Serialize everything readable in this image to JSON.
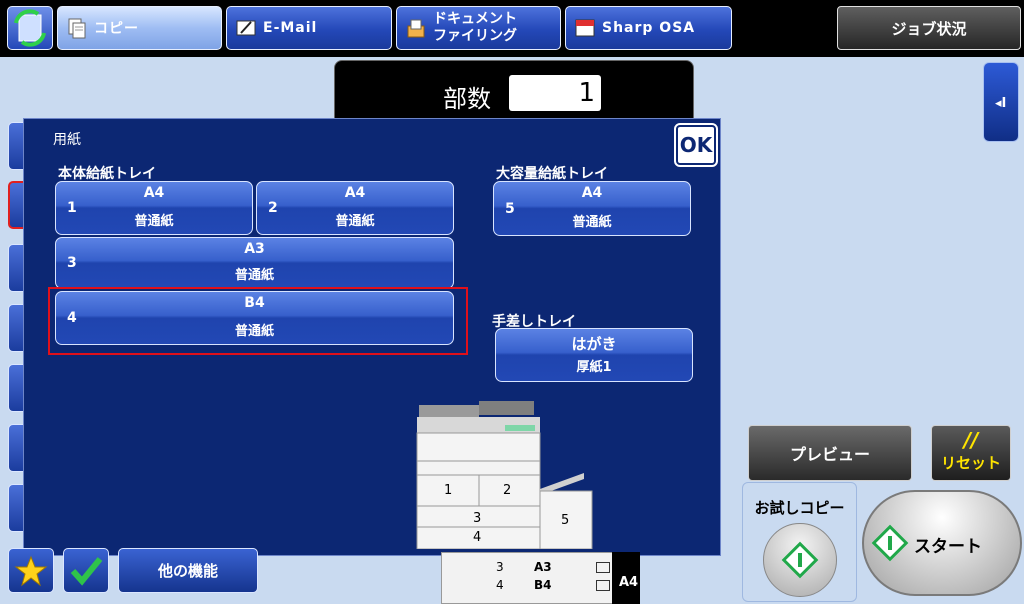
{
  "tabs": [
    {
      "label": "コピー",
      "icon": "copy-icon"
    },
    {
      "label": "E-Mail",
      "icon": "email-icon"
    },
    {
      "label_line1": "ドキュメント",
      "label_line2": "ファイリング",
      "icon": "document-filing-icon"
    },
    {
      "label": "Sharp OSA",
      "icon": "osa-icon"
    }
  ],
  "job_status_label": "ジョブ状況",
  "copies": {
    "label": "部数",
    "value": "1"
  },
  "dialog": {
    "title": "用紙",
    "ok_label": "OK",
    "main_tray_label": "本体給紙トレイ",
    "lcc_label": "大容量給紙トレイ",
    "bypass_label": "手差しトレイ",
    "trays": [
      {
        "num": "1",
        "size": "A4",
        "type": "普通紙"
      },
      {
        "num": "2",
        "size": "A4",
        "type": "普通紙"
      },
      {
        "num": "3",
        "size": "A3",
        "type": "普通紙"
      },
      {
        "num": "4",
        "size": "B4",
        "type": "普通紙"
      }
    ],
    "lcc_tray": {
      "num": "5",
      "size": "A4",
      "type": "普通紙"
    },
    "bypass_tray": {
      "size": "はがき",
      "type": "厚紙1"
    },
    "machine_labels": [
      "1",
      "2",
      "3",
      "4",
      "5"
    ]
  },
  "other_functions_label": "他の機能",
  "status": {
    "rows": [
      {
        "num": "3",
        "size": "A3"
      },
      {
        "num": "4",
        "size": "B4"
      }
    ],
    "selected_size": "A4"
  },
  "preview_label": "プレビュー",
  "reset_label": "リセット",
  "reset_symbol": "//",
  "trial_copy_label": "お試しコピー",
  "start_label": "スタート",
  "colors": {
    "accent": "#0c2773",
    "highlight": "#e0101a",
    "start_green": "#21a84a"
  }
}
